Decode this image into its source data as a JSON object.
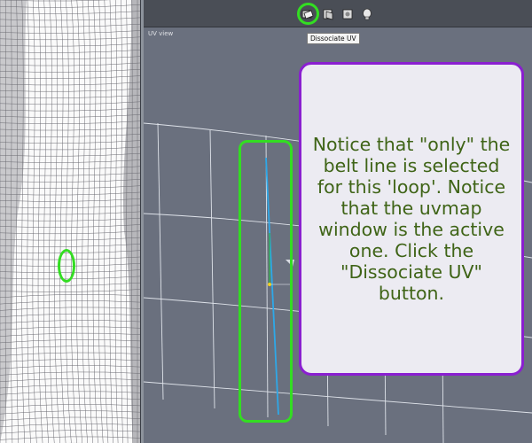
{
  "uv_panel": {
    "title": "UV view"
  },
  "toolbar": {
    "tools": [
      {
        "name": "dissociate-uv-tool-icon",
        "highlighted": true
      },
      {
        "name": "uv-tool-icon-2",
        "highlighted": false
      },
      {
        "name": "uv-tool-icon-3",
        "highlighted": false
      },
      {
        "name": "uv-tool-icon-4",
        "highlighted": false
      }
    ]
  },
  "tooltip": {
    "text": "Dissociate UV"
  },
  "callout": {
    "text": "Notice that \"only\" the belt line is selected for this 'loop'. Notice that the uvmap window is the active one. Click the \"Dissociate UV\" button."
  },
  "colors": {
    "highlight": "#33dd22",
    "callout_border": "#8a1fd0",
    "callout_text": "#3f6417",
    "selected_edge": "#2ea8e8",
    "uv_background": "#6a707e"
  }
}
